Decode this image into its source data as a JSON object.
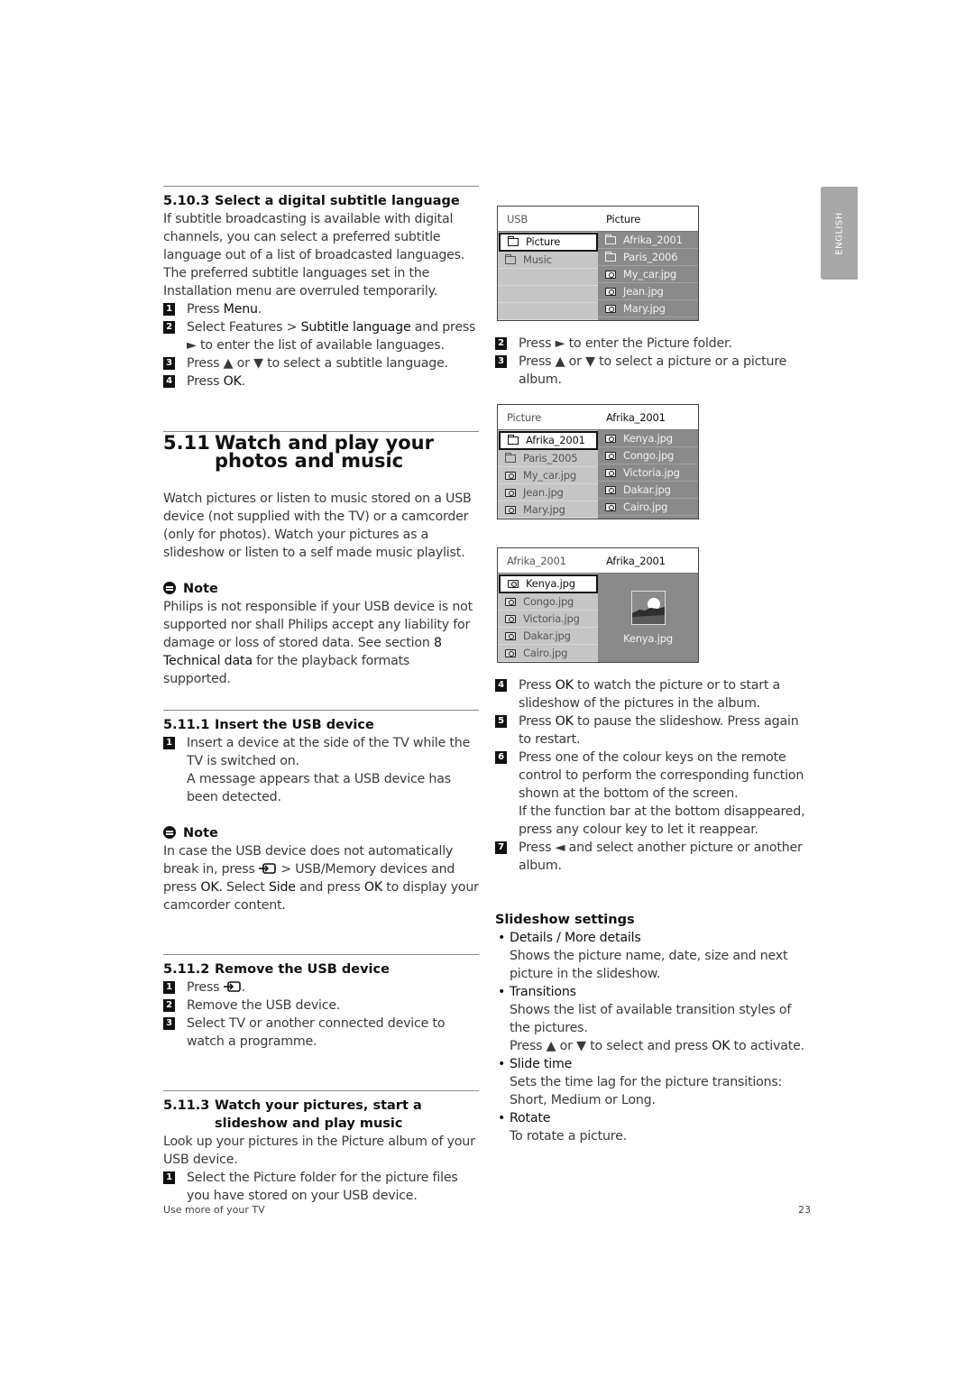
{
  "side_tab": {
    "label": "ENGLISH"
  },
  "sec_5_10_3": {
    "number": "5.10.3",
    "title": "Select a digital subtitle language",
    "intro": "If subtitle broadcasting is available with digital channels, you can select a preferred subtitle language out of a list of broadcasted languages. The preferred subtitle languages set in the Installation menu are overruled temporarily.",
    "steps": [
      {
        "n": "1",
        "a": "Press ",
        "b": "Menu",
        "c": "."
      },
      {
        "n": "2",
        "a": "Select Features > ",
        "b": "Subtitle language",
        "c": " and press",
        "d": "► to enter the list of available languages."
      },
      {
        "n": "3",
        "text": "Press ▲ or ▼ to select a subtitle language."
      },
      {
        "n": "4",
        "a": "Press ",
        "b": "OK",
        "c": "."
      }
    ]
  },
  "sec_5_11": {
    "number": "5.11",
    "title": "Watch and play your photos and music",
    "intro": "Watch pictures or listen to music stored on a USB device (not supplied with the TV) or a camcorder (only for photos). Watch your pictures as a slideshow or listen to a self made music playlist.",
    "note_label": "Note",
    "note_a": "Philips is not responsible if your USB device is not supported nor shall Philips accept any liability for damage or loss of stored data. See section ",
    "note_b": "8 Technical data",
    "note_c": " for the playback formats supported."
  },
  "sec_5_11_1": {
    "number": "5.11.1",
    "title": "Insert the USB device",
    "step1": "Insert a device at the side of the TV while the TV is switched on.",
    "step1_extra": "A message appears that a USB device has been detected.",
    "note_label": "Note",
    "note_1": "In case the USB device does not automatically break in, press ",
    "note_2": " > USB/Memory devices and press ",
    "note_ok1": "OK",
    "note_3": ". Select ",
    "note_side": "Side",
    "note_4": " and press ",
    "note_ok2": "OK",
    "note_5": " to display your camcorder content."
  },
  "sec_5_11_2": {
    "number": "5.11.2",
    "title": "Remove the USB device",
    "step1": "Press ",
    "step1_end": ".",
    "step2": "Remove the USB device.",
    "step3": "Select TV or another connected device to watch a programme."
  },
  "sec_5_11_3": {
    "number": "5.11.3",
    "title": "Watch your pictures, start a slideshow and play music",
    "intro": "Look up your pictures in the Picture album of your USB device.",
    "step1": "Select the Picture folder for the picture files you have stored on your USB device."
  },
  "screens": [
    {
      "header_left": "USB",
      "header_right": "Picture",
      "left": [
        {
          "icon": "folder",
          "label": "Picture",
          "selected": true
        },
        {
          "icon": "folder",
          "label": "Music"
        },
        {
          "label": ""
        },
        {
          "label": ""
        },
        {
          "label": ""
        }
      ],
      "right": [
        {
          "icon": "folder",
          "label": "Afrika_2001"
        },
        {
          "icon": "folder",
          "label": "Paris_2006"
        },
        {
          "icon": "camera",
          "label": "My_car.jpg"
        },
        {
          "icon": "camera",
          "label": "Jean.jpg"
        },
        {
          "icon": "camera",
          "label": "Mary.jpg"
        }
      ]
    },
    {
      "header_left": "Picture",
      "header_right": "Afrika_2001",
      "left": [
        {
          "icon": "folder",
          "label": "Afrika_2001",
          "selected": true
        },
        {
          "icon": "folder",
          "label": "Paris_2005"
        },
        {
          "icon": "camera",
          "label": "My_car.jpg"
        },
        {
          "icon": "camera",
          "label": "Jean.jpg"
        },
        {
          "icon": "camera",
          "label": "Mary.jpg"
        }
      ],
      "right": [
        {
          "icon": "camera",
          "label": "Kenya.jpg"
        },
        {
          "icon": "camera",
          "label": "Congo.jpg"
        },
        {
          "icon": "camera",
          "label": "Victoria.jpg"
        },
        {
          "icon": "camera",
          "label": "Dakar.jpg"
        },
        {
          "icon": "camera",
          "label": "Cairo.jpg"
        }
      ]
    },
    {
      "header_left": "Afrika_2001",
      "header_right": "Afrika_2001",
      "left": [
        {
          "icon": "camera",
          "label": "Kenya.jpg",
          "selected": true
        },
        {
          "icon": "camera",
          "label": "Congo.jpg"
        },
        {
          "icon": "camera",
          "label": "Victoria.jpg"
        },
        {
          "icon": "camera",
          "label": "Dakar.jpg"
        },
        {
          "icon": "camera",
          "label": "Cairo.jpg"
        }
      ],
      "preview_label": "Kenya.jpg"
    }
  ],
  "right_steps_a": [
    {
      "n": "2",
      "text": "Press ► to enter the Picture folder."
    },
    {
      "n": "3",
      "text": "Press ▲ or ▼ to select a picture or a picture album."
    }
  ],
  "right_steps_b": {
    "s4_n": "4",
    "s4_a": "Press ",
    "s4_b": "OK",
    "s4_c": " to watch the picture or to start a slideshow of the pictures in the album.",
    "s5_n": "5",
    "s5_a": "Press ",
    "s5_b": "OK",
    "s5_c": " to pause the slideshow. Press again to restart.",
    "s6_n": "6",
    "s6": "Press one of the colour keys on the remote control to perform the corresponding function shown at the bottom of the screen.",
    "s6_extra": "If the function bar at the bottom disappeared, press any colour key to let it reappear.",
    "s7_n": "7",
    "s7": "Press ◄ and select another picture or another album."
  },
  "slideshow": {
    "title": "Slideshow settings",
    "items": [
      {
        "term": "Details / More details",
        "desc": "Shows the picture name, date, size and next picture in the slideshow."
      },
      {
        "term": "Transitions",
        "desc": "Shows the list of available transition styles of the pictures.",
        "desc2a": "Press ▲ or ▼ to select and press ",
        "desc2b": "OK",
        "desc2c": " to activate."
      },
      {
        "term": "Slide time",
        "desc": "Sets the time lag for the picture transitions: Short, Medium or Long."
      },
      {
        "term": "Rotate",
        "desc": "To rotate a picture."
      }
    ]
  },
  "footer": {
    "left": "Use more of your TV",
    "page": "23"
  }
}
